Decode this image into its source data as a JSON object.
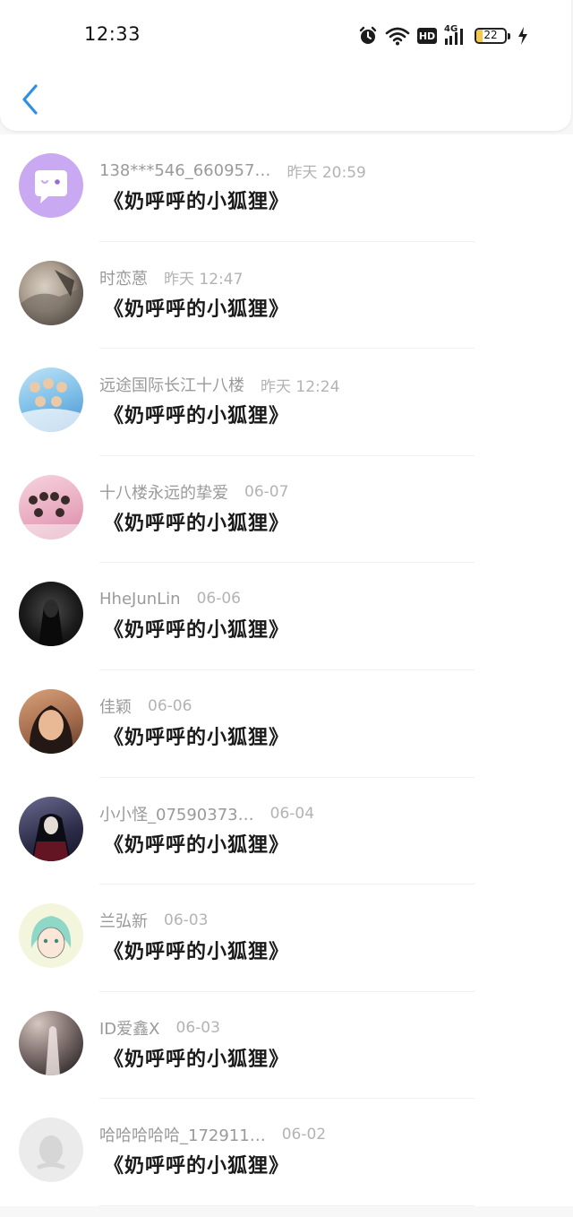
{
  "status_bar": {
    "time": "12:33",
    "battery": "22",
    "network": "4G",
    "hd": "HD",
    "icons": [
      "alarm-icon",
      "wifi-icon",
      "hd-icon",
      "signal-icon",
      "battery-icon",
      "charging-icon"
    ]
  },
  "header": {
    "back_icon": "chevron-left-icon",
    "accent_color": "#2f8fe6"
  },
  "comments": [
    {
      "username": "138***546_660957…",
      "time": "昨天 20:59",
      "content": "《奶呼呼的小狐狸》",
      "avatar": "purple-chat-bubble"
    },
    {
      "username": "时恋蒽",
      "time": "昨天 12:47",
      "content": "《奶呼呼的小狐狸》",
      "avatar": "photo"
    },
    {
      "username": "远途国际长江十八楼",
      "time": "昨天 12:24",
      "content": "《奶呼呼的小狐狸》",
      "avatar": "photo"
    },
    {
      "username": "十八楼永远的挚爱",
      "time": "06-07",
      "content": "《奶呼呼的小狐狸》",
      "avatar": "photo"
    },
    {
      "username": "HheJunLin",
      "time": "06-06",
      "content": "《奶呼呼的小狐狸》",
      "avatar": "photo"
    },
    {
      "username": "佳颖",
      "time": "06-06",
      "content": "《奶呼呼的小狐狸》",
      "avatar": "photo"
    },
    {
      "username": "小小怪_07590373…",
      "time": "06-04",
      "content": "《奶呼呼的小狐狸》",
      "avatar": "photo"
    },
    {
      "username": "兰弘新",
      "time": "06-03",
      "content": "《奶呼呼的小狐狸》",
      "avatar": "drawing"
    },
    {
      "username": "ID爱鑫X",
      "time": "06-03",
      "content": "《奶呼呼的小狐狸》",
      "avatar": "photo"
    },
    {
      "username": "哈哈哈哈哈_172911…",
      "time": "06-02",
      "content": "《奶呼呼的小狐狸》",
      "avatar": "default-penguin"
    }
  ]
}
